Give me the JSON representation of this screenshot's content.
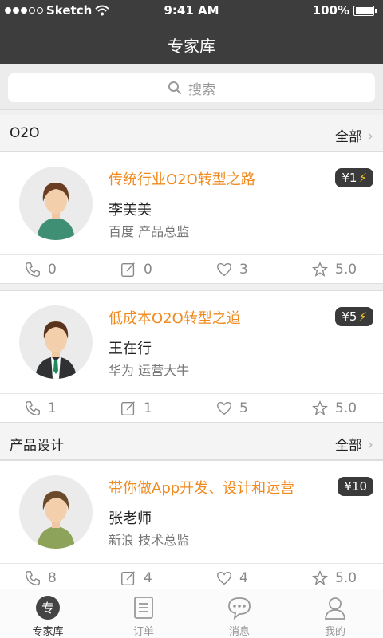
{
  "status_bar": {
    "carrier": "Sketch",
    "time": "9:41 AM",
    "battery": "100%"
  },
  "nav": {
    "title": "专家库"
  },
  "search": {
    "placeholder": "搜索"
  },
  "sections": [
    {
      "title": "O2O",
      "more": "全部",
      "experts": [
        {
          "topic": "传统行业O2O转型之路",
          "name": "李美美",
          "org": "百度 产品总监",
          "price": "¥1",
          "calls": "0",
          "edits": "0",
          "likes": "3",
          "rating": "5.0"
        },
        {
          "topic": "低成本O2O转型之道",
          "name": "王在行",
          "org": "华为 运营大牛",
          "price": "¥5",
          "calls": "1",
          "edits": "1",
          "likes": "5",
          "rating": "5.0"
        }
      ]
    },
    {
      "title": "产品设计",
      "more": "全部",
      "experts": [
        {
          "topic": "带你做App开发、设计和运营",
          "name": "张老师",
          "org": "新浪 技术总监",
          "price": "¥10",
          "calls": "8",
          "edits": "4",
          "likes": "4",
          "rating": "5.0"
        }
      ]
    }
  ],
  "tabs": [
    {
      "label": "专家库",
      "icon": "expert-icon"
    },
    {
      "label": "订单",
      "icon": "order-list-icon"
    },
    {
      "label": "消息",
      "icon": "message-bubble-icon"
    },
    {
      "label": "我的",
      "icon": "profile-icon"
    }
  ],
  "colors": {
    "accent": "#f08a1f",
    "nav_bg": "#3d3d3d",
    "badge_bg": "#3a3a3a",
    "bolt": "#f5c518"
  }
}
